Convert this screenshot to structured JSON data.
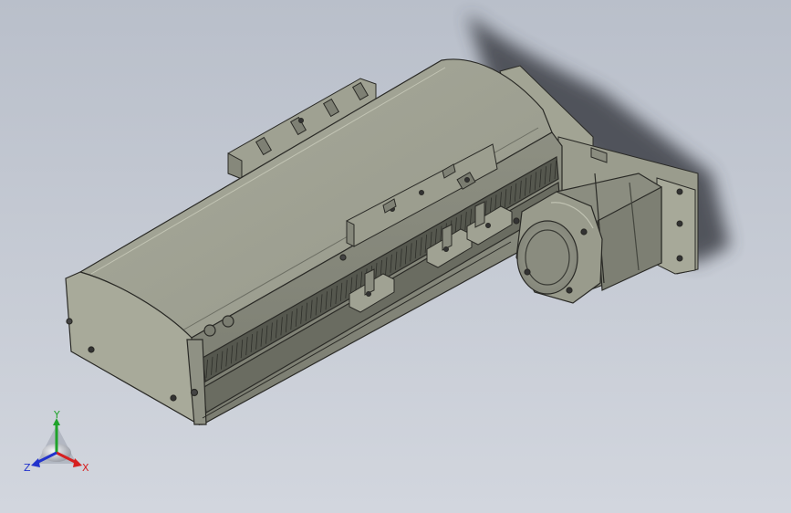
{
  "viewport": {
    "background_top": "#b9bfca",
    "background_bottom": "#d2d6de"
  },
  "model": {
    "body_color": "#a3a595",
    "body_top_color": "#9c9e8f",
    "edge_color": "#2a2a26",
    "shadow_color": "#3a3c42",
    "motor_color": "#8e9082"
  },
  "triad": {
    "x_label": "X",
    "y_label": "Y",
    "z_label": "Z",
    "x_color": "#d62020",
    "y_color": "#1fa32a",
    "z_color": "#2233cc"
  }
}
